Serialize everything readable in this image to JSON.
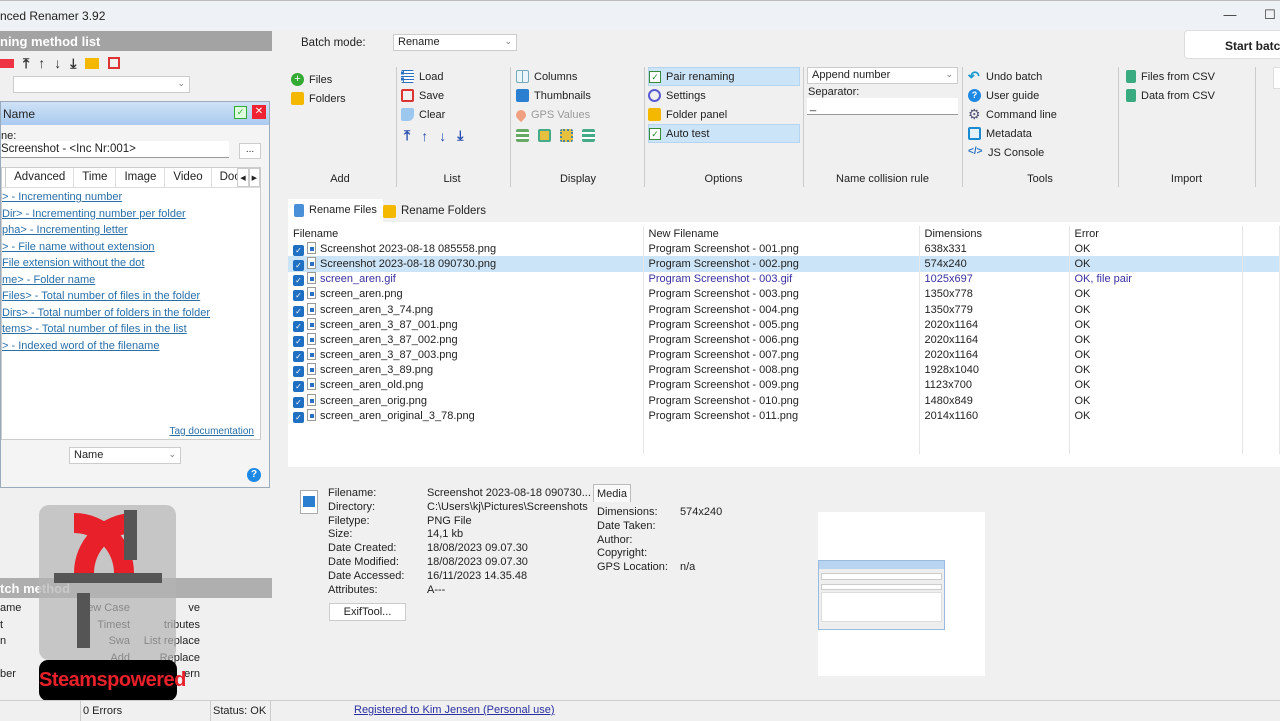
{
  "window": {
    "title": "nced Renamer 3.92",
    "minimize": "—",
    "maximize": "☐"
  },
  "left": {
    "method_list_title": "ning method list",
    "method_panel": {
      "title": "Name",
      "new_name_label": "ne:",
      "new_name_value": "Screenshot - <Inc Nr:001>",
      "browse": "...",
      "tabs": [
        "Advanced",
        "Time",
        "Image",
        "Video",
        "Docu"
      ],
      "tags": [
        "> - Incrementing number",
        "Dir> - Incrementing number per folder",
        "pha> - Incrementing letter",
        "> - File name without extension",
        "File extension without the dot",
        "me> - Folder name",
        "Files> - Total number of files in the folder",
        "Dirs> - Total number of folders in the folder",
        "tems> - Total number of files in the list",
        "> - Indexed word of the filename"
      ],
      "tag_doc": "Tag documentation",
      "apply_to_value": "Name",
      "help": "?"
    },
    "batch_method_title": "tch method",
    "batch_methods": [
      [
        "ame",
        "New Case",
        "ve"
      ],
      [
        "t",
        "Timest",
        "tributes"
      ],
      [
        "n",
        "Swa",
        "List replace"
      ],
      [
        "",
        "Add",
        "Replace"
      ],
      [
        "ber",
        "",
        "ern"
      ]
    ],
    "watermark": "Steamspowered"
  },
  "batch_mode": {
    "label": "Batch mode:",
    "value": "Rename"
  },
  "start_button": "Start batch",
  "ribbon": {
    "add": {
      "label": "Add",
      "items": [
        "Files",
        "Folders"
      ]
    },
    "list": {
      "label": "List",
      "items": [
        "Load",
        "Save",
        "Clear"
      ]
    },
    "display": {
      "label": "Display",
      "items": [
        "Columns",
        "Thumbnails",
        "GPS Values"
      ]
    },
    "options": {
      "label": "Options",
      "items": [
        "Pair renaming",
        "Settings",
        "Folder panel",
        "Auto test"
      ]
    },
    "collision": {
      "label": "Name collision rule",
      "value": "Append number",
      "separator_label": "Separator:",
      "separator_value": "_"
    },
    "tools": {
      "label": "Tools",
      "items": [
        "Undo batch",
        "User guide",
        "Command line",
        "Metadata",
        "JS Console"
      ]
    },
    "import": {
      "label": "Import",
      "items": [
        "Files from CSV",
        "Data from CSV"
      ]
    }
  },
  "tabs": [
    "Rename Files",
    "Rename Folders"
  ],
  "table": {
    "columns": [
      "Filename",
      "New Filename",
      "Dimensions",
      "Error"
    ],
    "rows": [
      [
        "Screenshot 2023-08-18 085558.png",
        "Program Screenshot - 001.png",
        "638x331",
        "OK"
      ],
      [
        "Screenshot 2023-08-18 090730.png",
        "Program Screenshot - 002.png",
        "574x240",
        "OK"
      ],
      [
        "screen_aren.gif",
        "Program Screenshot - 003.gif",
        "1025x697",
        "OK, file pair"
      ],
      [
        "screen_aren.png",
        "Program Screenshot - 003.png",
        "1350x778",
        "OK"
      ],
      [
        "screen_aren_3_74.png",
        "Program Screenshot - 004.png",
        "1350x779",
        "OK"
      ],
      [
        "screen_aren_3_87_001.png",
        "Program Screenshot - 005.png",
        "2020x1164",
        "OK"
      ],
      [
        "screen_aren_3_87_002.png",
        "Program Screenshot - 006.png",
        "2020x1164",
        "OK"
      ],
      [
        "screen_aren_3_87_003.png",
        "Program Screenshot - 007.png",
        "2020x1164",
        "OK"
      ],
      [
        "screen_aren_3_89.png",
        "Program Screenshot - 008.png",
        "1928x1040",
        "OK"
      ],
      [
        "screen_aren_old.png",
        "Program Screenshot - 009.png",
        "1123x700",
        "OK"
      ],
      [
        "screen_aren_orig.png",
        "Program Screenshot - 010.png",
        "1480x849",
        "OK"
      ],
      [
        "screen_aren_original_3_78.png",
        "Program Screenshot - 011.png",
        "2014x1160",
        "OK"
      ]
    ],
    "selected_row": 1,
    "pair_row": 2
  },
  "details": {
    "labels": [
      "Filename:",
      "Directory:",
      "Filetype:",
      "Size:",
      "Date Created:",
      "Date Modified:",
      "Date Accessed:",
      "Attributes:"
    ],
    "values": [
      "Screenshot 2023-08-18 090730...",
      "C:\\Users\\kj\\Pictures\\Screenshots",
      "PNG File",
      "14,1 kb",
      "18/08/2023 09.07.30",
      "18/08/2023 09.07.30",
      "16/11/2023 14.35.48",
      "A---"
    ],
    "exiftool": "ExifTool...",
    "media_tab": "Media",
    "media_labels": [
      "Dimensions:",
      "Date Taken:",
      "Author:",
      "Copyright:",
      "GPS Location:"
    ],
    "media_values": [
      "574x240",
      "",
      "",
      "",
      "n/a"
    ]
  },
  "status": {
    "errors": "0 Errors",
    "status": "Status: OK",
    "registered": "Registered to Kim Jensen (Personal use)"
  },
  "colors": {
    "accent": "#1f6fc2",
    "link": "#2a6fa8",
    "pair": "#3a30a0",
    "selected": "#cce4f7"
  }
}
